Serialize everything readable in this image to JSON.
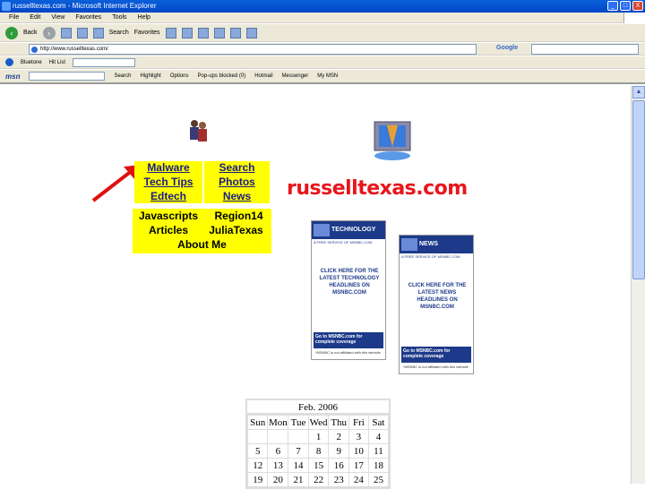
{
  "window": {
    "title": "russelltexas.com - Microsoft Internet Explorer",
    "min": "_",
    "max": "□",
    "close": "X"
  },
  "menu": [
    "File",
    "Edit",
    "View",
    "Favorites",
    "Tools",
    "Help"
  ],
  "toolbar": {
    "back": "Back",
    "search": "Search",
    "favorites": "Favorites"
  },
  "address": {
    "label": "Address",
    "url": "http://www.russelltexas.com/"
  },
  "google": {
    "label": "Google"
  },
  "links": {
    "bluetone": "Bluetone",
    "hitlist": "Hit List"
  },
  "msn": {
    "logo": "msn",
    "search": "Search",
    "highlight": "Highlight",
    "options": "Options",
    "popups": "Pop-ups blocked (0)",
    "hotmail": "Hotmail",
    "messenger": "Messenger",
    "mymsn": "My MSN"
  },
  "nav": {
    "malware": "Malware",
    "search": "Search",
    "techtips": "Tech Tips",
    "photos": "Photos",
    "edtech": "Edtech",
    "news": "News",
    "javascripts": "Javascripts",
    "region14": "Region14",
    "articles": "Articles",
    "juliatexas": "JuliaTexas",
    "aboutme": "About Me"
  },
  "site_title": "russelltexas.com",
  "promo_tech": {
    "head": "TECHNOLOGY",
    "sub": "A FREE SERVICE OF MSNBC.COM",
    "body": "CLICK HERE FOR THE LATEST TECHNOLOGY HEADLINES ON MSNBC.COM",
    "foot": "Go to MSNBC.com for complete coverage",
    "note": "*MSNBC is not affiliated with this website"
  },
  "promo_news": {
    "head": "NEWS",
    "sub": "A FREE SERVICE OF MSNBC.COM",
    "body": "CLICK HERE FOR THE LATEST NEWS HEADLINES ON MSNBC.COM",
    "foot": "Go to MSNBC.com for complete coverage",
    "note": "*MSNBC is not affiliated with this website"
  },
  "calendar": {
    "title": "Feb. 2006",
    "days": [
      "Sun",
      "Mon",
      "Tue",
      "Wed",
      "Thu",
      "Fri",
      "Sat"
    ],
    "weeks": [
      [
        "",
        "",
        "",
        "1",
        "2",
        "3",
        "4"
      ],
      [
        "5",
        "6",
        "7",
        "8",
        "9",
        "10",
        "11"
      ],
      [
        "12",
        "13",
        "14",
        "15",
        "16",
        "17",
        "18"
      ],
      [
        "19",
        "20",
        "21",
        "22",
        "23",
        "24",
        "25"
      ]
    ]
  }
}
